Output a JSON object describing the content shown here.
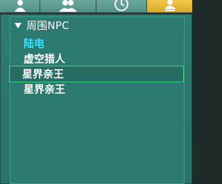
{
  "tabs": [
    {
      "icon": "person-icon",
      "active": false
    },
    {
      "icon": "group-icon",
      "active": false
    },
    {
      "icon": "clock-icon",
      "active": false
    },
    {
      "icon": "location-person-icon",
      "active": true
    }
  ],
  "section": {
    "title": "周围NPC",
    "expanded": true
  },
  "npcs": [
    {
      "name": "陆电",
      "highlight": true
    },
    {
      "name": "虚空猎人",
      "highlight": false
    },
    {
      "name": "星界亲王",
      "selected": true
    },
    {
      "name": "星界亲王",
      "selected": false
    }
  ],
  "colors": {
    "highlight_text": "#33e5ff",
    "active_tab": "#f3c84a",
    "selection_border": "#48d38a"
  }
}
